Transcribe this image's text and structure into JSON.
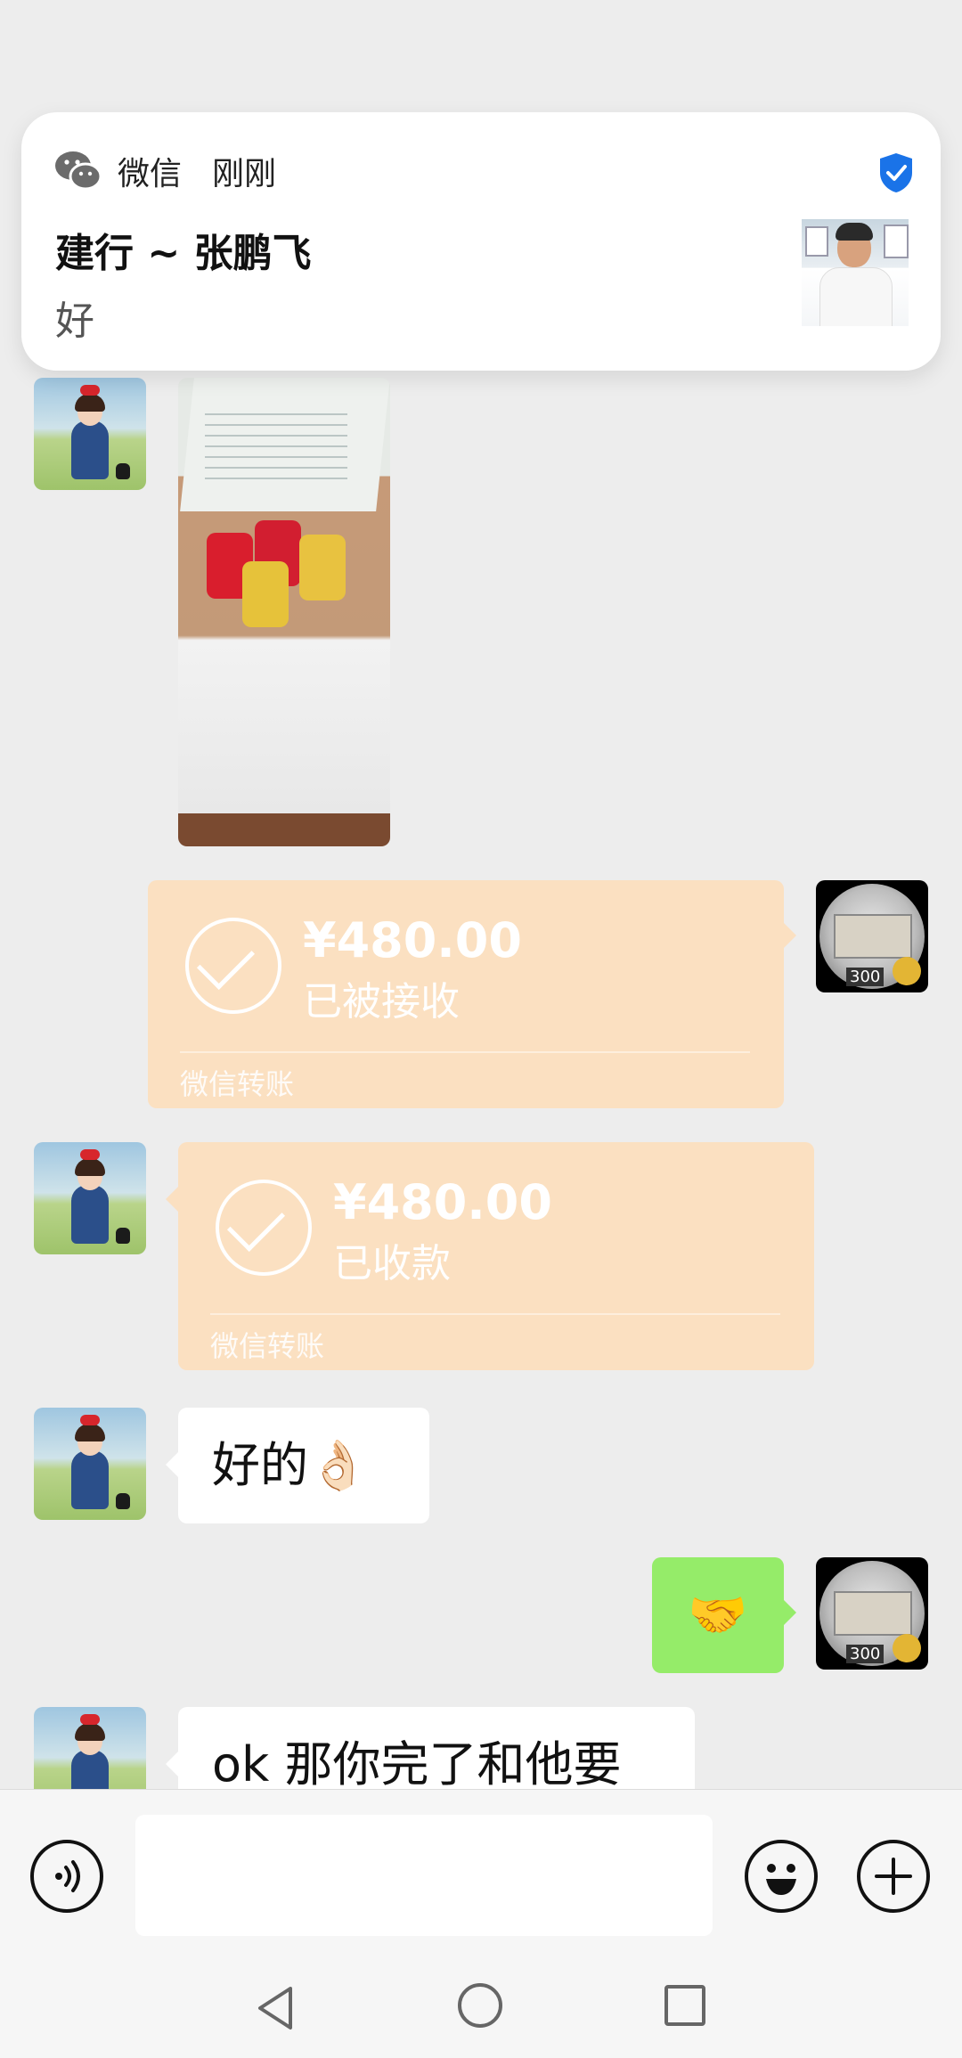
{
  "notification": {
    "app_name": "微信",
    "time": "刚刚",
    "sender": "建行 ~ 张鹏飞",
    "message": "好"
  },
  "messages": {
    "transfer_sent": {
      "amount": "¥480.00",
      "status": "已被接收",
      "label": "微信转账"
    },
    "transfer_received": {
      "amount": "¥480.00",
      "status": "已收款",
      "label": "微信转账"
    },
    "text_ok": "好的👌🏻",
    "emoji_handshake": "🤝",
    "text_partial": "ok 那你完了和他要"
  },
  "coin_avatar": {
    "badge_text": "300"
  },
  "icons": {
    "voice": "voice-input-icon",
    "emoji": "emoji-icon",
    "plus": "plus-icon",
    "nav_back": "nav-back-icon",
    "nav_home": "nav-home-icon",
    "nav_recent": "nav-recent-icon"
  },
  "colors": {
    "transfer_bg": "#fbe0c1",
    "self_bubble": "#95ec69",
    "verified_blue": "#1a73e8"
  }
}
